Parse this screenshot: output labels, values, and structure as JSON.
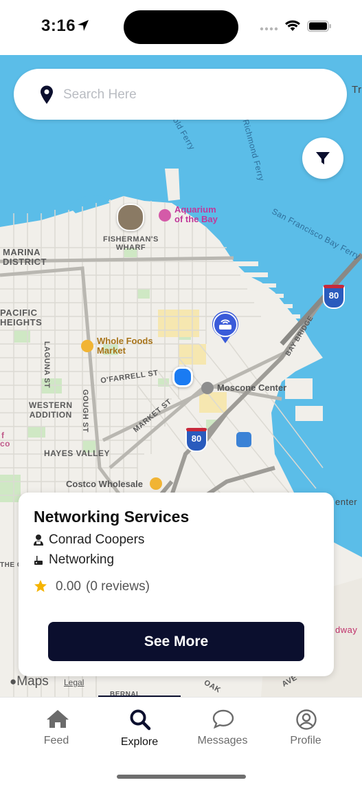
{
  "status_bar": {
    "time": "3:16"
  },
  "search": {
    "placeholder": "Search Here"
  },
  "map": {
    "labels": {
      "golden_ferry": "Gold Ferry",
      "richmond_ferry": "Richmond Ferry",
      "sf_bay_ferry": "San Francisco Bay Ferry",
      "fishermans_wharf": "FISHERMAN'S\nWHARF",
      "marina_district": "MARINA\nDISTRICT",
      "pacific_heights": "PACIFIC\nHEIGHTS",
      "laguna_st": "LAGUNA ST",
      "gough_st": "GOUGH ST",
      "ofarrell_st": "O'FARRELL ST",
      "market_st": "MARKET ST",
      "western_addition": "WESTERN\nADDITION",
      "hayes_valley": "HAYES VALLEY",
      "bay_bridge": "BAY BRIDGE",
      "oak": "OAK",
      "ave": "AVE",
      "bernal": "BERNAL",
      "tr": "Tr",
      "enter": "enter",
      "dway": "dway",
      "co": "co",
      "f": "f",
      "the_c": "THE C"
    },
    "pois": {
      "aquarium": "Aquarium\nof the Bay",
      "whole_foods": "Whole Foods\nMarket",
      "moscone": "Moscone Center",
      "costco": "Costco Wholesale"
    },
    "shields": {
      "i80_a": "80",
      "i80_b": "80"
    },
    "attribution": {
      "maps": "Maps",
      "legal": "Legal"
    }
  },
  "card": {
    "title": "Networking Services",
    "provider": "Conrad Coopers",
    "category": "Networking",
    "rating": "0.00",
    "reviews": "(0 reviews)",
    "button": "See More"
  },
  "tabs": [
    {
      "label": "Feed",
      "icon": "home-icon"
    },
    {
      "label": "Explore",
      "icon": "search-icon"
    },
    {
      "label": "Messages",
      "icon": "chat-icon"
    },
    {
      "label": "Profile",
      "icon": "profile-icon"
    }
  ],
  "colors": {
    "accent": "#0b0f2e",
    "water": "#5bbde8",
    "land": "#f1efea",
    "star": "#f5b400"
  }
}
